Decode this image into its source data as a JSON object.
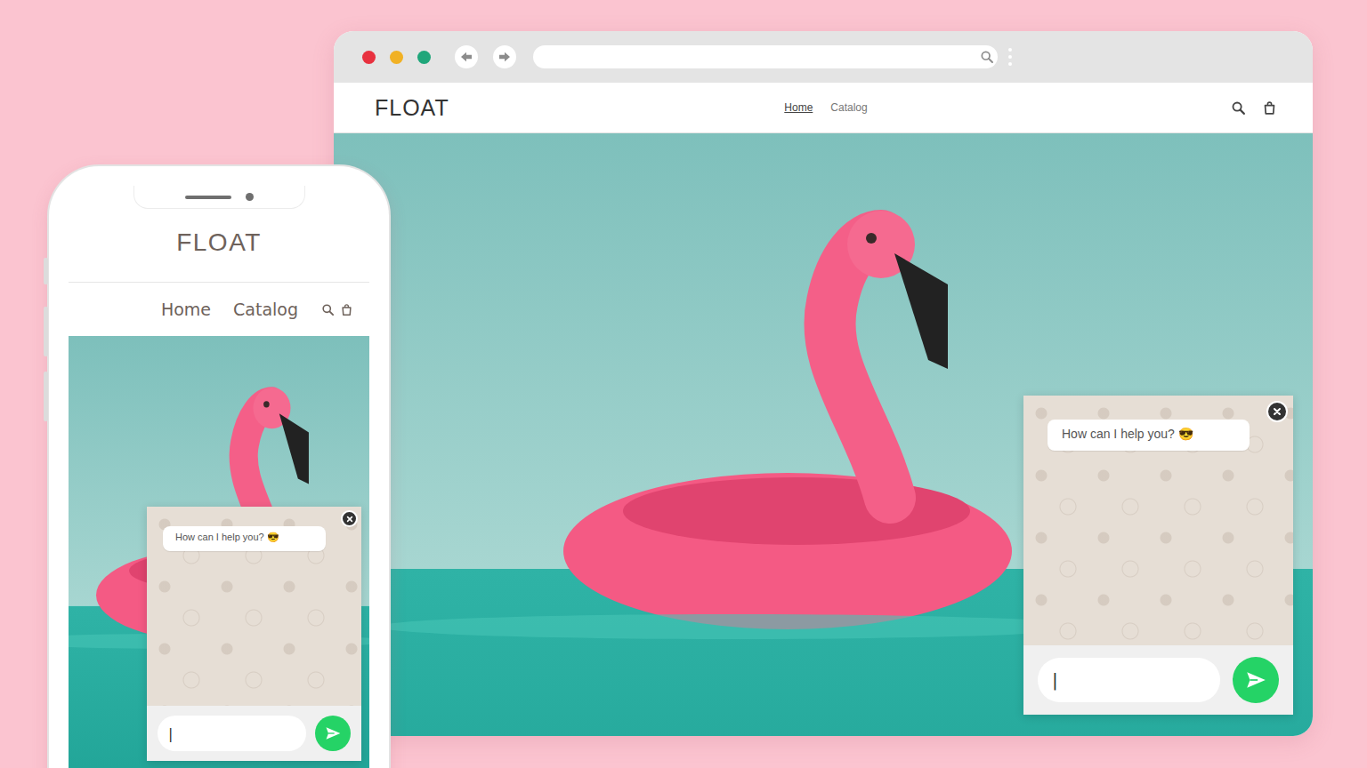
{
  "views": [
    {
      "kind": "desktop",
      "logo": "FLOAT",
      "nav": [
        {
          "label": "Home",
          "selected": true
        },
        {
          "label": "Catalog",
          "selected": false
        }
      ],
      "chat": {
        "greeting": "How can I help you? 😎",
        "caret": "|"
      }
    },
    {
      "kind": "mobile",
      "logo": "FLOAT",
      "nav": [
        {
          "label": "Home"
        },
        {
          "label": "Catalog"
        }
      ],
      "chat": {
        "greeting": "How can I help you? 😎",
        "caret": "|"
      }
    }
  ]
}
